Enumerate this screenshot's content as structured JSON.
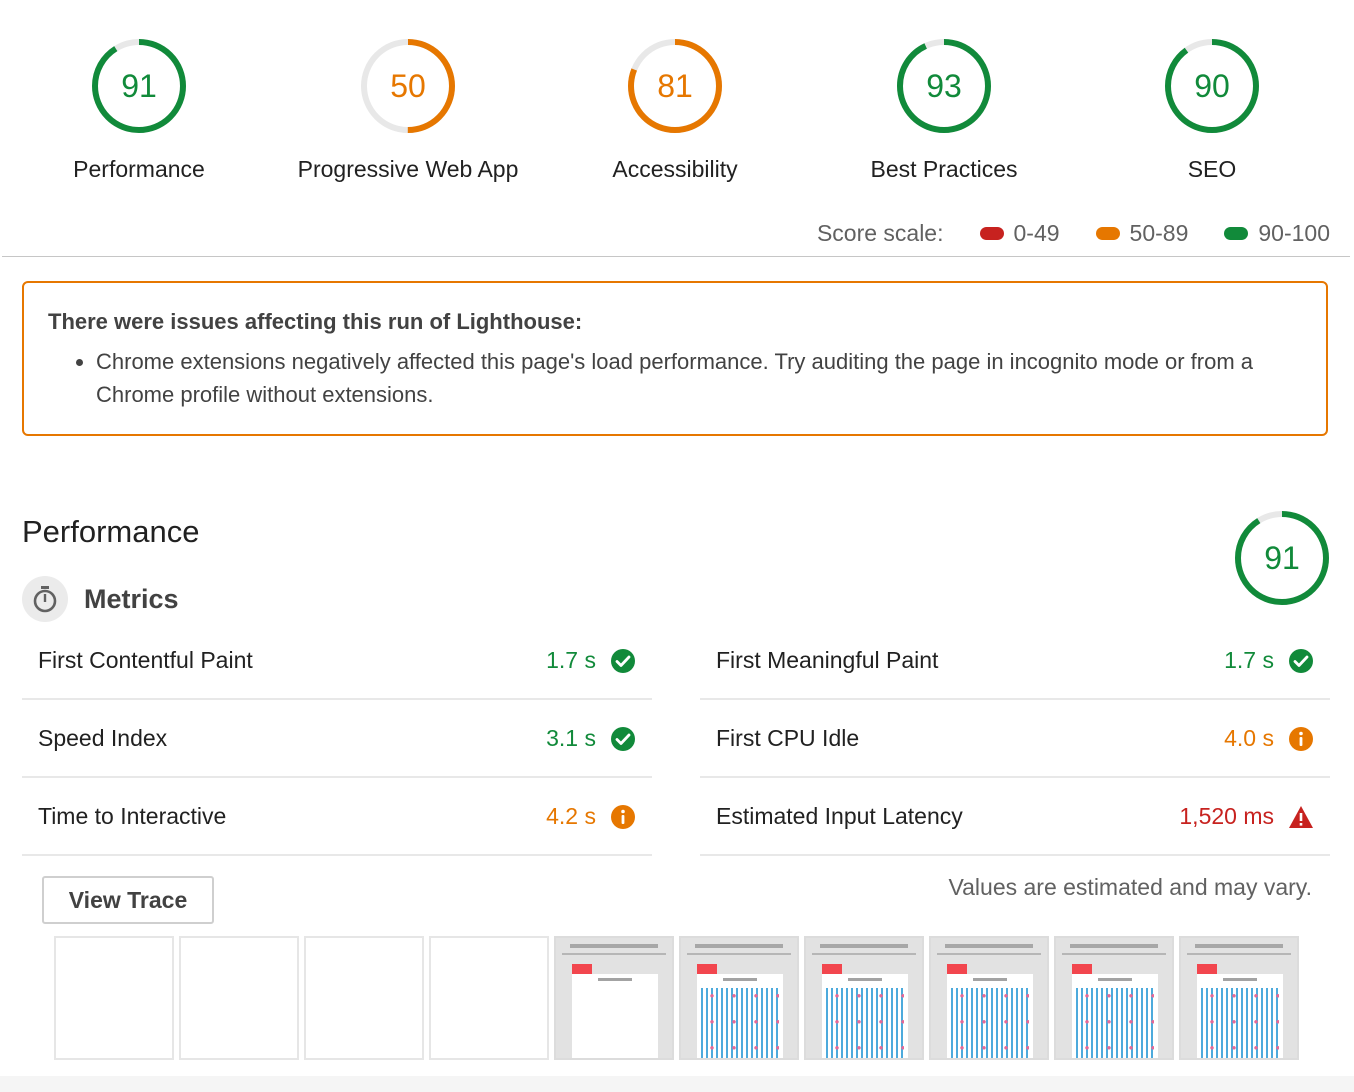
{
  "categories": [
    {
      "label": "Performance",
      "score": "91",
      "value": 91,
      "color": "#118a3a"
    },
    {
      "label": "Progressive Web App",
      "score": "50",
      "value": 50,
      "color": "#e67700"
    },
    {
      "label": "Accessibility",
      "score": "81",
      "value": 81,
      "color": "#e67700"
    },
    {
      "label": "Best Practices",
      "score": "93",
      "value": 93,
      "color": "#118a3a"
    },
    {
      "label": "SEO",
      "score": "90",
      "value": 90,
      "color": "#118a3a"
    }
  ],
  "score_scale": {
    "label": "Score scale:",
    "ranges": [
      {
        "label": "0-49",
        "color": "#c7221f"
      },
      {
        "label": "50-89",
        "color": "#e67700"
      },
      {
        "label": "90-100",
        "color": "#118a3a"
      }
    ]
  },
  "warning": {
    "title": "There were issues affecting this run of Lighthouse:",
    "items": [
      "Chrome extensions negatively affected this page's load performance. Try auditing the page in incognito mode or from a Chrome profile without extensions."
    ]
  },
  "performance": {
    "title": "Performance",
    "score": "91",
    "value": 91,
    "color": "#118a3a",
    "metrics_title": "Metrics",
    "metrics": [
      {
        "name": "First Contentful Paint",
        "value": "1.7 s",
        "status": "pass"
      },
      {
        "name": "First Meaningful Paint",
        "value": "1.7 s",
        "status": "pass"
      },
      {
        "name": "Speed Index",
        "value": "3.1 s",
        "status": "pass"
      },
      {
        "name": "First CPU Idle",
        "value": "4.0 s",
        "status": "average"
      },
      {
        "name": "Time to Interactive",
        "value": "4.2 s",
        "status": "average"
      },
      {
        "name": "Estimated Input Latency",
        "value": "1,520 ms",
        "status": "fail"
      }
    ],
    "view_trace_label": "View Trace",
    "disclaimer": "Values are estimated and may vary.",
    "filmstrip": [
      "blank",
      "blank",
      "blank",
      "blank",
      "header",
      "loaded",
      "loaded",
      "loaded",
      "loaded",
      "loaded"
    ]
  }
}
